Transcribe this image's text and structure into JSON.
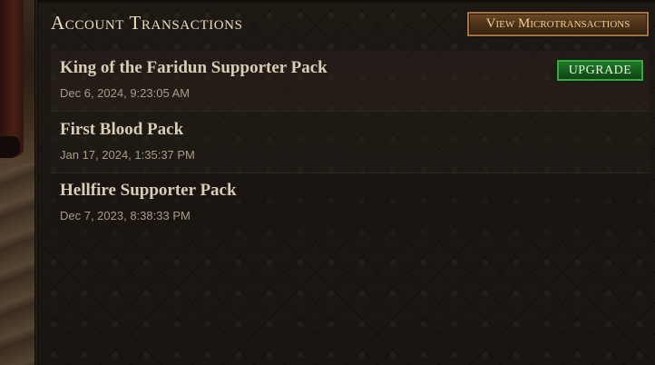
{
  "header": {
    "title": "Account Transactions",
    "view_button_label": "View Microtransactions"
  },
  "transactions": [
    {
      "name": "King of the Faridun Supporter Pack",
      "date": "Dec 6, 2024, 9:23:05 AM",
      "action_label": "UPGRADE"
    },
    {
      "name": "First Blood Pack",
      "date": "Jan 17, 2024, 1:35:37 PM"
    },
    {
      "name": "Hellfire Supporter Pack",
      "date": "Dec 7, 2023, 8:38:33 PM"
    }
  ],
  "colors": {
    "title_text": "#e8dcc4",
    "view_button_border": "#a3743d",
    "upgrade_button": "#1f7a27",
    "panel_bg": "#1c1713"
  }
}
